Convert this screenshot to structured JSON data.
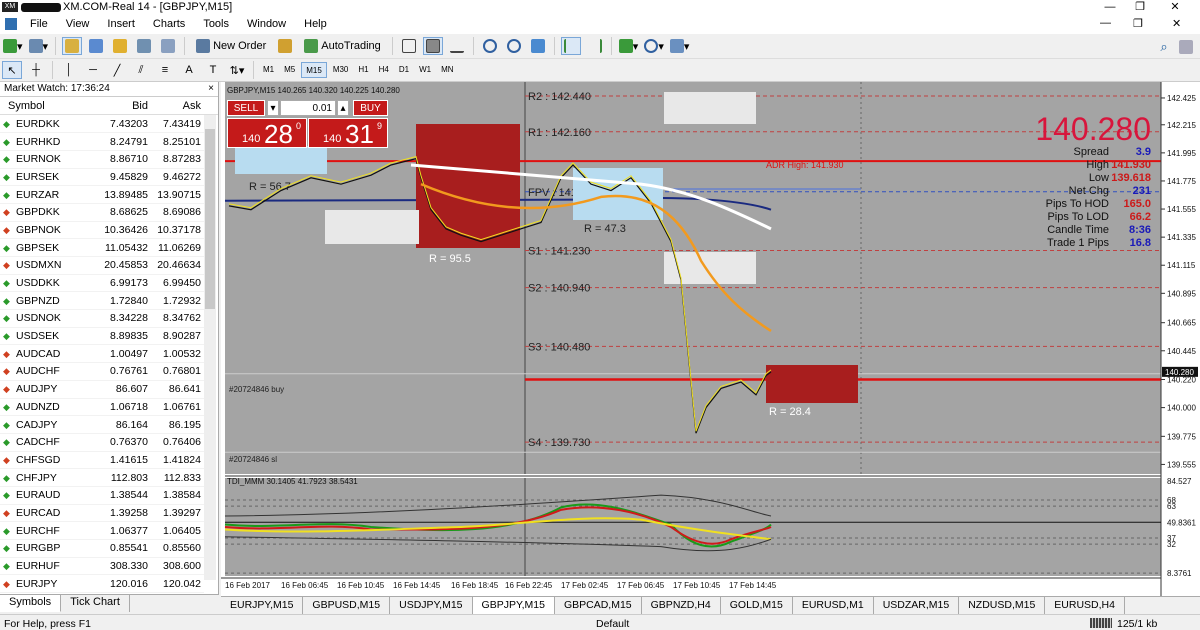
{
  "window": {
    "title": "XM.COM-Real 14 - [GBPJPY,M15]",
    "logo": "XM",
    "controls": [
      "—",
      "❐",
      "✕"
    ]
  },
  "menu": [
    "File",
    "View",
    "Insert",
    "Charts",
    "Tools",
    "Window",
    "Help"
  ],
  "toolbar": {
    "new_order": "New Order",
    "autotrading": "AutoTrading",
    "timeframes": [
      "M1",
      "M5",
      "M15",
      "M30",
      "H1",
      "H4",
      "D1",
      "W1",
      "MN"
    ],
    "active_timeframe": "M15"
  },
  "market_watch": {
    "header": "Market Watch: 17:36:24",
    "columns": [
      "Symbol",
      "Bid",
      "Ask"
    ],
    "rows": [
      {
        "symbol": "EURDKK",
        "bid": "7.43203",
        "ask": "7.43419",
        "dir": "up"
      },
      {
        "symbol": "EURHKD",
        "bid": "8.24791",
        "ask": "8.25101",
        "dir": "up"
      },
      {
        "symbol": "EURNOK",
        "bid": "8.86710",
        "ask": "8.87283",
        "dir": "up"
      },
      {
        "symbol": "EURSEK",
        "bid": "9.45829",
        "ask": "9.46272",
        "dir": "up"
      },
      {
        "symbol": "EURZAR",
        "bid": "13.89485",
        "ask": "13.90715",
        "dir": "up"
      },
      {
        "symbol": "GBPDKK",
        "bid": "8.68625",
        "ask": "8.69086",
        "dir": "dn"
      },
      {
        "symbol": "GBPNOK",
        "bid": "10.36426",
        "ask": "10.37178",
        "dir": "dn"
      },
      {
        "symbol": "GBPSEK",
        "bid": "11.05432",
        "ask": "11.06269",
        "dir": "up"
      },
      {
        "symbol": "USDMXN",
        "bid": "20.45853",
        "ask": "20.46634",
        "dir": "dn"
      },
      {
        "symbol": "USDDKK",
        "bid": "6.99173",
        "ask": "6.99450",
        "dir": "up"
      },
      {
        "symbol": "GBPNZD",
        "bid": "1.72840",
        "ask": "1.72932",
        "dir": "up"
      },
      {
        "symbol": "USDNOK",
        "bid": "8.34228",
        "ask": "8.34762",
        "dir": "up"
      },
      {
        "symbol": "USDSEK",
        "bid": "8.89835",
        "ask": "8.90287",
        "dir": "up"
      },
      {
        "symbol": "AUDCAD",
        "bid": "1.00497",
        "ask": "1.00532",
        "dir": "dn"
      },
      {
        "symbol": "AUDCHF",
        "bid": "0.76761",
        "ask": "0.76801",
        "dir": "dn"
      },
      {
        "symbol": "AUDJPY",
        "bid": "86.607",
        "ask": "86.641",
        "dir": "dn"
      },
      {
        "symbol": "AUDNZD",
        "bid": "1.06718",
        "ask": "1.06761",
        "dir": "up"
      },
      {
        "symbol": "CADJPY",
        "bid": "86.164",
        "ask": "86.195",
        "dir": "up"
      },
      {
        "symbol": "CADCHF",
        "bid": "0.76370",
        "ask": "0.76406",
        "dir": "up"
      },
      {
        "symbol": "CHFSGD",
        "bid": "1.41615",
        "ask": "1.41824",
        "dir": "dn"
      },
      {
        "symbol": "CHFJPY",
        "bid": "112.803",
        "ask": "112.833",
        "dir": "up"
      },
      {
        "symbol": "EURAUD",
        "bid": "1.38544",
        "ask": "1.38584",
        "dir": "up"
      },
      {
        "symbol": "EURCAD",
        "bid": "1.39258",
        "ask": "1.39297",
        "dir": "dn"
      },
      {
        "symbol": "EURCHF",
        "bid": "1.06377",
        "ask": "1.06405",
        "dir": "up"
      },
      {
        "symbol": "EURGBP",
        "bid": "0.85541",
        "ask": "0.85560",
        "dir": "up"
      },
      {
        "symbol": "EURHUF",
        "bid": "308.330",
        "ask": "308.600",
        "dir": "up"
      },
      {
        "symbol": "EURJPY",
        "bid": "120.016",
        "ask": "120.042",
        "dir": "dn"
      }
    ],
    "tabs": [
      "Symbols",
      "Tick Chart"
    ]
  },
  "one_click": {
    "sell_label": "SELL",
    "buy_label": "BUY",
    "lot": "0.01",
    "sell_prefix": "140",
    "sell_big": "28",
    "sell_sup": "0",
    "buy_prefix": "140",
    "buy_big": "31",
    "buy_sup": "9"
  },
  "chart": {
    "header": "GBPJPY,M15  140.265 140.320 140.225 140.280",
    "big_price": "140.280",
    "stats": [
      {
        "label": "Spread",
        "value": "3.9",
        "color": "#1a1ab8"
      },
      {
        "label": "High",
        "value": "141.930",
        "color": "#cc1a1a"
      },
      {
        "label": "Low",
        "value": "139.618",
        "color": "#cc1a1a"
      },
      {
        "label": "Net Chg",
        "value": "231",
        "color": "#1a1ab8"
      },
      {
        "label": "Pips To HOD",
        "value": "165.0",
        "color": "#cc1a1a"
      },
      {
        "label": "Pips To LOD",
        "value": "66.2",
        "color": "#cc1a1a"
      },
      {
        "label": "Candle Time",
        "value": "8:36",
        "color": "#1a1ab8"
      },
      {
        "label": "Trade 1 Pips",
        "value": "16.8",
        "color": "#1a1ab8"
      }
    ],
    "pivots": [
      {
        "label": "R2 : 142.440",
        "price": 142.44
      },
      {
        "label": "R1 : 142.160",
        "price": 142.16
      },
      {
        "label": "FPV : 141.690",
        "price": 141.69
      },
      {
        "label": "S1 : 141.230",
        "price": 141.23
      },
      {
        "label": "S2 : 140.940",
        "price": 140.94
      },
      {
        "label": "S3 : 140.480",
        "price": 140.48
      },
      {
        "label": "S4 : 139.730",
        "price": 139.73
      }
    ],
    "adr_high_label": "ADR High: 141.930",
    "adr_high": 141.93,
    "blue_line": 141.712,
    "range_labels": [
      "R = 56.7",
      "R = 95.5",
      "R = 47.3",
      "R = 28.4"
    ],
    "order_labels": [
      "#20724846 buy",
      "#20724846 sl"
    ],
    "price_axis": [
      "142.425",
      "142.215",
      "141.995",
      "141.775",
      "141.555",
      "141.335",
      "141.115",
      "140.895",
      "140.665",
      "140.445",
      "140.220",
      "140.000",
      "139.775",
      "139.555"
    ],
    "price_axis_values": [
      142.425,
      142.215,
      141.995,
      141.775,
      141.555,
      141.335,
      141.115,
      140.895,
      140.665,
      140.445,
      140.22,
      140.0,
      139.775,
      139.555
    ],
    "current_price_tag": "140.280",
    "current_price": 140.28,
    "time_axis": [
      "16 Feb 2017",
      "16 Feb 06:45",
      "16 Feb 10:45",
      "16 Feb 14:45",
      "16 Feb 18:45",
      "16 Feb 22:45",
      "17 Feb 02:45",
      "17 Feb 06:45",
      "17 Feb 10:45",
      "17 Feb 14:45"
    ],
    "indicator_header": "TDI_MMM 30.1405 41.7923 38.5431",
    "indicator_axis": [
      "68",
      "63",
      "49.8361",
      "37",
      "32",
      "8.3761"
    ],
    "indicator_values": [
      68,
      63,
      49.8361,
      37,
      32,
      8.3761
    ],
    "indicator_top": "84.527"
  },
  "chart_tabs": [
    "EURJPY,M15",
    "GBPUSD,M15",
    "USDJPY,M15",
    "GBPJPY,M15",
    "GBPCAD,M15",
    "GBPNZD,H4",
    "GOLD,M15",
    "EURUSD,M1",
    "USDZAR,M15",
    "NZDUSD,M15",
    "EURUSD,H4"
  ],
  "active_chart_tab": "GBPJPY,M15",
  "status": {
    "help": "For Help, press F1",
    "profile": "Default",
    "traffic": "125/1 kb"
  }
}
